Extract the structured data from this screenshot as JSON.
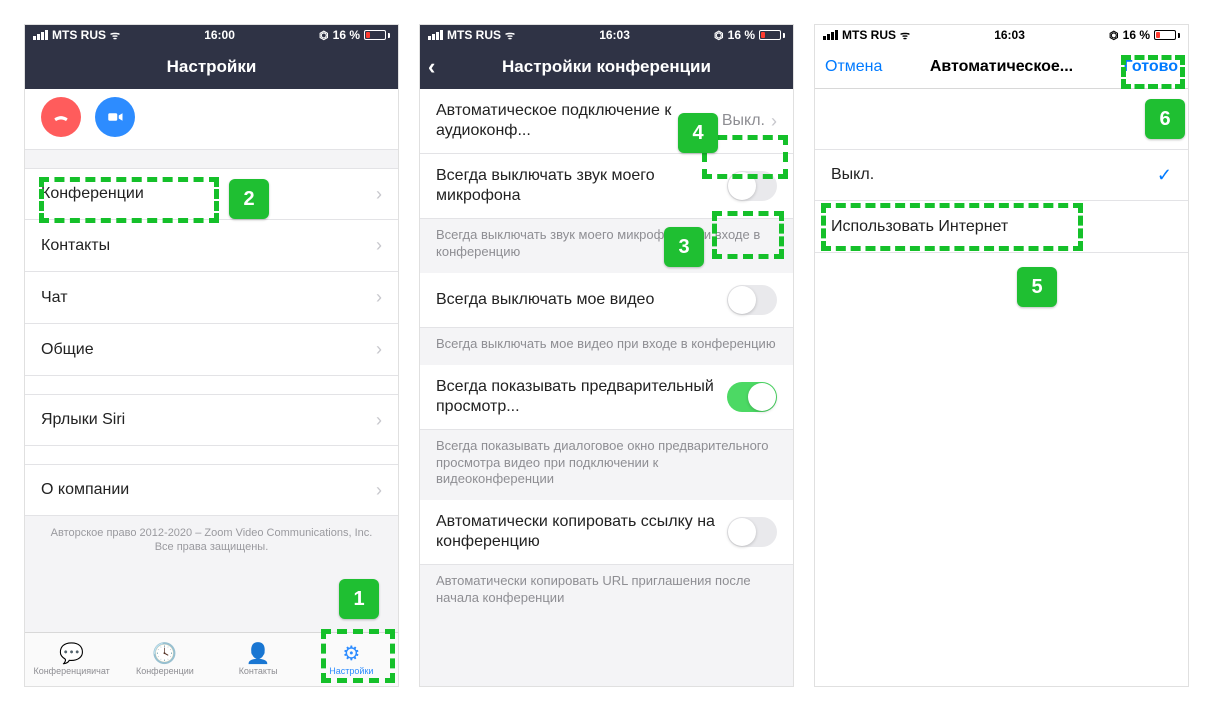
{
  "status": {
    "carrier": "MTS RUS",
    "battery_text": "16 %",
    "lock_glyph": "⏣",
    "wifi_glyph": "ᯤ"
  },
  "phone1": {
    "time": "16:00",
    "title": "Настройки",
    "menu": {
      "conferences": "Конференции",
      "contacts": "Контакты",
      "chat": "Чат",
      "general": "Общие",
      "siri": "Ярлыки Siri",
      "about": "О компании"
    },
    "copyright_line1": "Авторское право 2012-2020 – Zoom Video Communications, Inc.",
    "copyright_line2": "Все права защищены.",
    "tabs": {
      "chat": "Конференцияичат",
      "meetings": "Конференции",
      "contacts": "Контакты",
      "settings": "Настройки"
    }
  },
  "phone2": {
    "time": "16:03",
    "title": "Настройки конференции",
    "rows": {
      "auto_audio_label": "Автоматическое подключение к аудиоконф...",
      "auto_audio_value": "Выкл.",
      "mute_mic_label": "Всегда выключать звук моего микрофона",
      "mute_mic_hint": "Всегда выключать звук моего микрофона при входе в конференцию",
      "video_off_label": "Всегда выключать мое видео",
      "video_off_hint": "Всегда выключать мое видео при входе в конференцию",
      "preview_label": "Всегда показывать предварительный просмотр...",
      "preview_hint": "Всегда показывать диалоговое окно предварительного просмотра видео при подключении к видеоконференции",
      "copy_link_label": "Автоматически копировать ссылку на конференцию",
      "copy_link_hint": "Автоматически копировать URL приглашения после начала конференции"
    }
  },
  "phone3": {
    "time": "16:03",
    "cancel": "Отмена",
    "title": "Автоматическое...",
    "done": "Готово",
    "opt_off": "Выкл.",
    "opt_internet": "Использовать Интернет"
  },
  "annotations": {
    "n1": "1",
    "n2": "2",
    "n3": "3",
    "n4": "4",
    "n5": "5",
    "n6": "6"
  }
}
